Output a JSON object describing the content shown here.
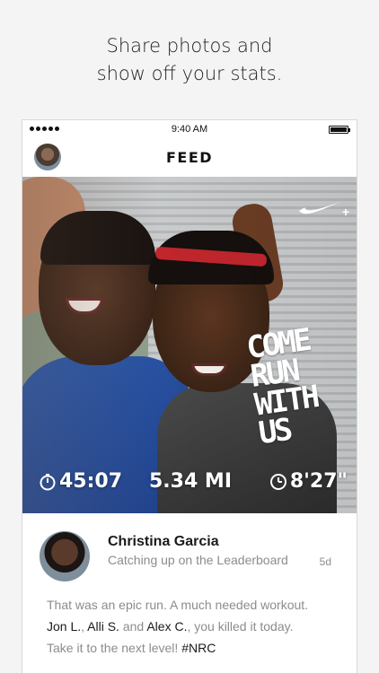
{
  "headline": {
    "line1": "Share photos and",
    "line2": "show off your stats."
  },
  "status_bar": {
    "time": "9:40 AM"
  },
  "nav": {
    "title": "FEED"
  },
  "photo": {
    "overlay_text": [
      "COME",
      "RUN",
      "WITH",
      "US"
    ],
    "stats": {
      "duration": "45:07",
      "distance": "5.34 MI",
      "pace": "8'27\""
    },
    "brand_icon": "nike-swoosh-plus-icon"
  },
  "post": {
    "author": "Christina Garcia",
    "subtitle": "Catching up on the Leaderboard",
    "age": "5d",
    "line1": "That was an epic run. A much needed workout.",
    "mention1": "Jon L.",
    "sep1": ", ",
    "mention2": "Alli S.",
    "and_text": " and ",
    "mention3": "Alex C.",
    "line2_end": ", you killed it today.",
    "line3_start": "Take it to the next level! ",
    "hashtag": "#NRC"
  },
  "colors": {
    "background": "#f4f4f4",
    "headband": "#c0262c",
    "shirt": "#2f5fb5"
  }
}
